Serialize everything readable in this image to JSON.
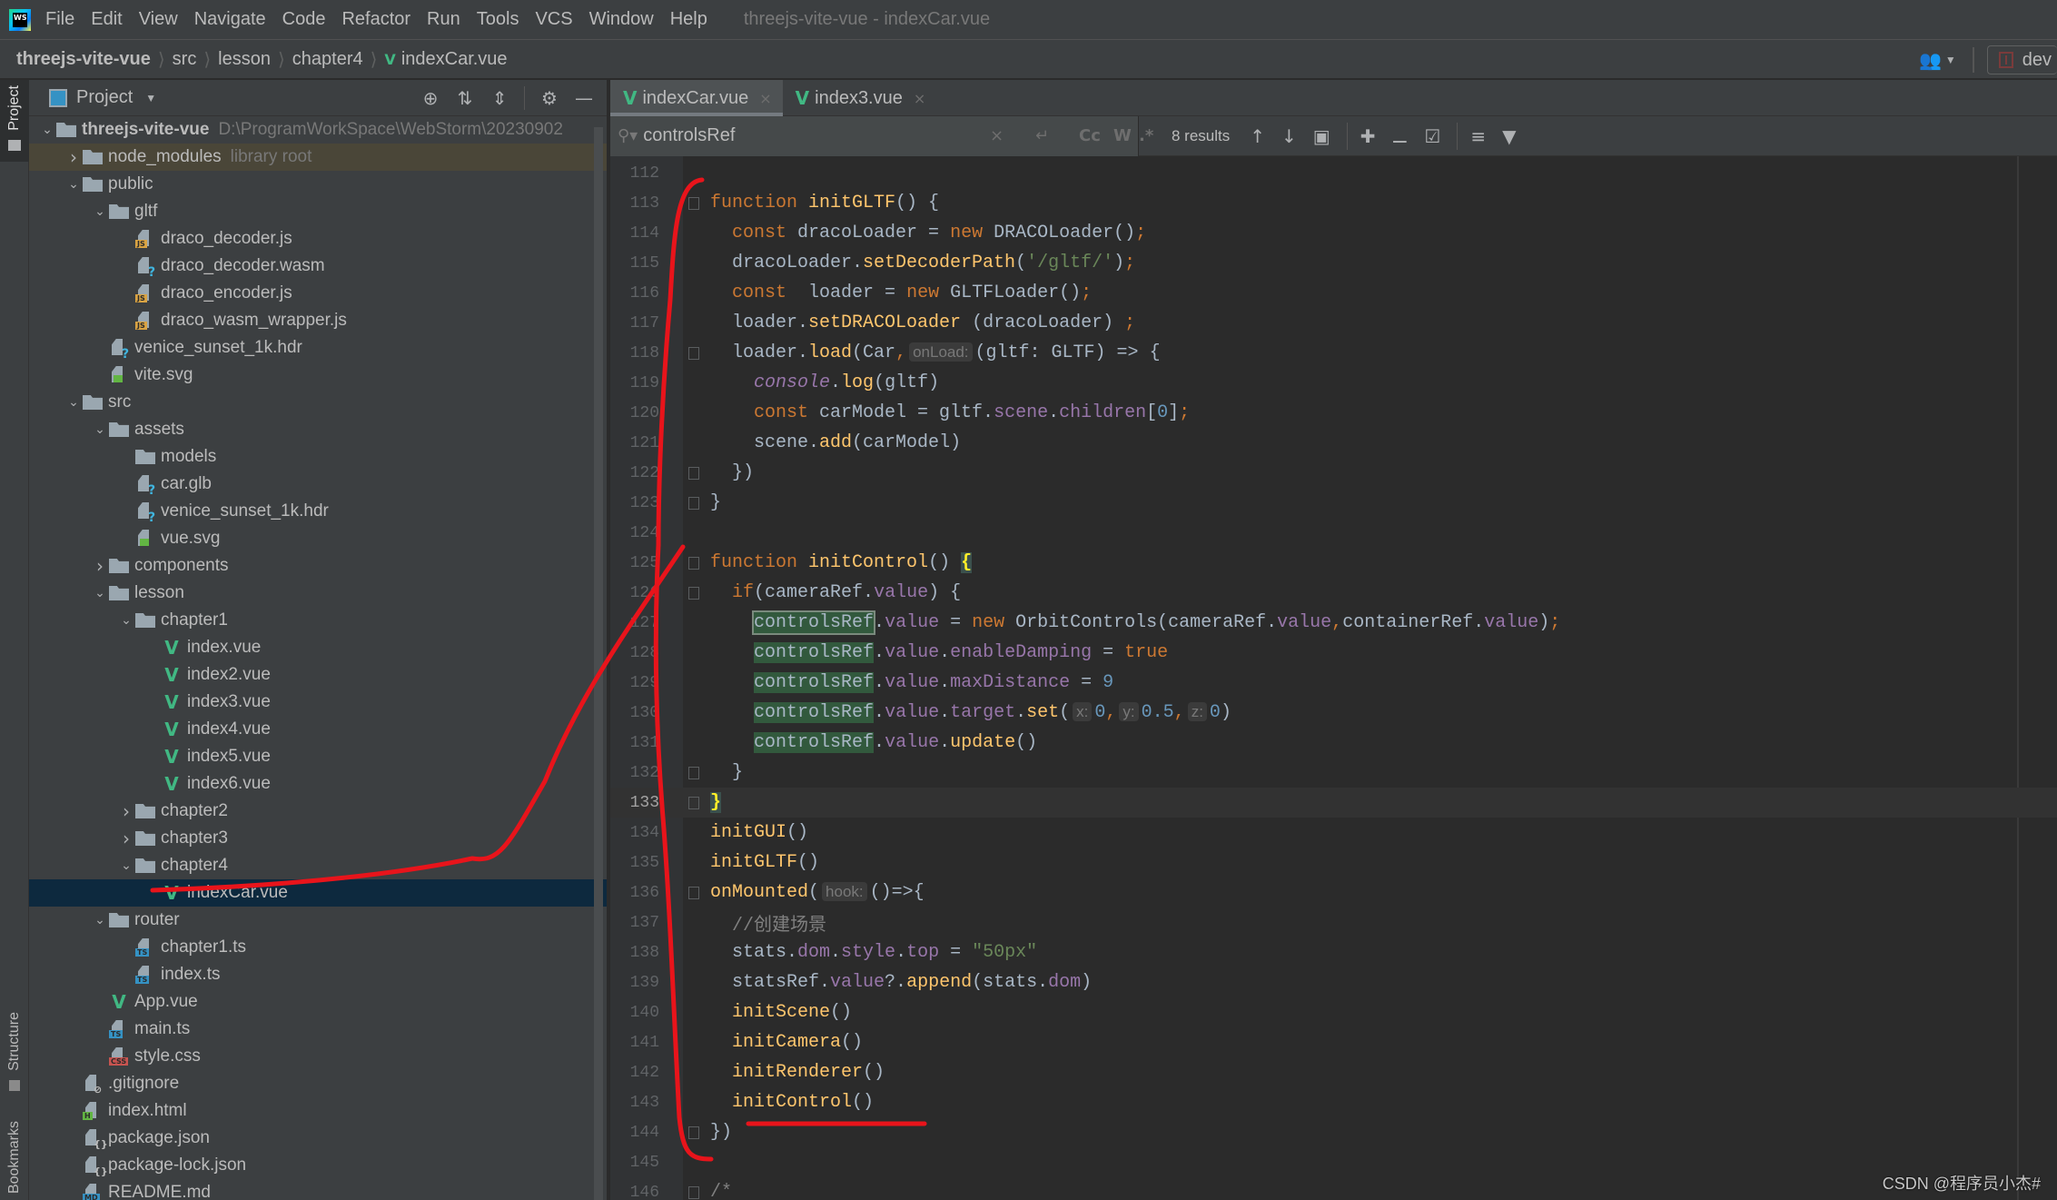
{
  "menu": {
    "app_logo": "WS",
    "items": [
      "File",
      "Edit",
      "View",
      "Navigate",
      "Code",
      "Refactor",
      "Run",
      "Tools",
      "VCS",
      "Window",
      "Help"
    ],
    "window_title": "threejs-vite-vue - indexCar.vue"
  },
  "breadcrumb": {
    "items": [
      "threejs-vite-vue",
      "src",
      "lesson",
      "chapter4",
      "indexCar.vue"
    ],
    "run_config": "dev"
  },
  "stripe": {
    "project": "Project",
    "structure": "Structure",
    "bookmarks": "Bookmarks"
  },
  "project_panel": {
    "title": "Project",
    "tree": [
      {
        "label": "threejs-vite-vue",
        "hint": "D:\\ProgramWorkSpace\\WebStorm\\20230902",
        "type": "folder",
        "depth": 0,
        "expanded": true,
        "bold": true
      },
      {
        "label": "node_modules",
        "hint": "library root",
        "type": "folder",
        "depth": 1,
        "expanded": false,
        "library": true
      },
      {
        "label": "public",
        "type": "folder",
        "depth": 1,
        "expanded": true
      },
      {
        "label": "gltf",
        "type": "folder",
        "depth": 2,
        "expanded": true
      },
      {
        "label": "draco_decoder.js",
        "type": "js",
        "depth": 3
      },
      {
        "label": "draco_decoder.wasm",
        "type": "unknown",
        "depth": 3
      },
      {
        "label": "draco_encoder.js",
        "type": "js",
        "depth": 3
      },
      {
        "label": "draco_wasm_wrapper.js",
        "type": "js",
        "depth": 3
      },
      {
        "label": "venice_sunset_1k.hdr",
        "type": "unknown",
        "depth": 2
      },
      {
        "label": "vite.svg",
        "type": "image",
        "depth": 2
      },
      {
        "label": "src",
        "type": "folder",
        "depth": 1,
        "expanded": true
      },
      {
        "label": "assets",
        "type": "folder",
        "depth": 2,
        "expanded": true
      },
      {
        "label": "models",
        "type": "folder",
        "depth": 3
      },
      {
        "label": "car.glb",
        "type": "unknown",
        "depth": 3
      },
      {
        "label": "venice_sunset_1k.hdr",
        "type": "unknown",
        "depth": 3
      },
      {
        "label": "vue.svg",
        "type": "image",
        "depth": 3
      },
      {
        "label": "components",
        "type": "folder",
        "depth": 2,
        "expanded": false
      },
      {
        "label": "lesson",
        "type": "folder",
        "depth": 2,
        "expanded": true
      },
      {
        "label": "chapter1",
        "type": "folder",
        "depth": 3,
        "expanded": true
      },
      {
        "label": "index.vue",
        "type": "vue",
        "depth": 4
      },
      {
        "label": "index2.vue",
        "type": "vue",
        "depth": 4
      },
      {
        "label": "index3.vue",
        "type": "vue",
        "depth": 4
      },
      {
        "label": "index4.vue",
        "type": "vue",
        "depth": 4
      },
      {
        "label": "index5.vue",
        "type": "vue",
        "depth": 4
      },
      {
        "label": "index6.vue",
        "type": "vue",
        "depth": 4
      },
      {
        "label": "chapter2",
        "type": "folder",
        "depth": 3,
        "expanded": false
      },
      {
        "label": "chapter3",
        "type": "folder",
        "depth": 3,
        "expanded": false
      },
      {
        "label": "chapter4",
        "type": "folder",
        "depth": 3,
        "expanded": true
      },
      {
        "label": "indexCar.vue",
        "type": "vue",
        "depth": 4,
        "selected": true
      },
      {
        "label": "router",
        "type": "folder",
        "depth": 2,
        "expanded": true
      },
      {
        "label": "chapter1.ts",
        "type": "ts",
        "depth": 3
      },
      {
        "label": "index.ts",
        "type": "ts",
        "depth": 3
      },
      {
        "label": "App.vue",
        "type": "vue",
        "depth": 2
      },
      {
        "label": "main.ts",
        "type": "ts",
        "depth": 2
      },
      {
        "label": "style.css",
        "type": "css",
        "depth": 2
      },
      {
        "label": ".gitignore",
        "type": "ignore",
        "depth": 1
      },
      {
        "label": "index.html",
        "type": "html",
        "depth": 1
      },
      {
        "label": "package.json",
        "type": "json",
        "depth": 1
      },
      {
        "label": "package-lock.json",
        "type": "json",
        "depth": 1
      },
      {
        "label": "README.md",
        "type": "md",
        "depth": 1
      }
    ]
  },
  "editor": {
    "tabs": [
      {
        "label": "indexCar.vue",
        "active": true
      },
      {
        "label": "index3.vue",
        "active": false
      }
    ],
    "search": {
      "value": "controlsRef",
      "results": "8 results",
      "options": [
        "Cc",
        "W",
        ".*"
      ]
    },
    "current_line": 133,
    "lines": [
      {
        "n": 112,
        "tokens": []
      },
      {
        "n": 113,
        "fold": true,
        "tokens": [
          [
            "kw",
            "function "
          ],
          [
            "fn",
            "initGLTF"
          ],
          [
            "",
            "() {"
          ]
        ]
      },
      {
        "n": 114,
        "tokens": [
          [
            "",
            "  "
          ],
          [
            "kw",
            "const "
          ],
          [
            "",
            "dracoLoader = "
          ],
          [
            "kw",
            "new "
          ],
          [
            "",
            "DRACOLoader()"
          ],
          [
            "kw",
            ";"
          ]
        ]
      },
      {
        "n": 115,
        "tokens": [
          [
            "",
            "  dracoLoader."
          ],
          [
            "fn",
            "setDecoderPath"
          ],
          [
            "",
            "("
          ],
          [
            "str",
            "'/gltf/'"
          ],
          [
            "",
            ")"
          ],
          [
            "kw",
            ";"
          ]
        ]
      },
      {
        "n": 116,
        "tokens": [
          [
            "",
            "  "
          ],
          [
            "kw",
            "const  "
          ],
          [
            "",
            "loader = "
          ],
          [
            "kw",
            "new "
          ],
          [
            "",
            "GLTFLoader()"
          ],
          [
            "kw",
            ";"
          ]
        ]
      },
      {
        "n": 117,
        "tokens": [
          [
            "",
            "  loader."
          ],
          [
            "fn",
            "setDRACOLoader"
          ],
          [
            "",
            " (dracoLoader) "
          ],
          [
            "kw",
            ";"
          ]
        ]
      },
      {
        "n": 118,
        "fold": true,
        "tokens": [
          [
            "",
            "  loader."
          ],
          [
            "fn",
            "load"
          ],
          [
            "",
            "(Car"
          ],
          [
            "kw",
            ","
          ],
          [
            "hint",
            "onLoad:"
          ],
          [
            "",
            "(gltf: GLTF) => {"
          ]
        ]
      },
      {
        "n": 119,
        "tokens": [
          [
            "",
            "    "
          ],
          [
            "glob",
            "console"
          ],
          [
            "",
            "."
          ],
          [
            "fn",
            "log"
          ],
          [
            "",
            "(gltf)"
          ]
        ]
      },
      {
        "n": 120,
        "tokens": [
          [
            "",
            "    "
          ],
          [
            "kw",
            "const "
          ],
          [
            "",
            "carModel = gltf."
          ],
          [
            "prop",
            "scene"
          ],
          [
            "",
            "."
          ],
          [
            "prop",
            "children"
          ],
          [
            "",
            "["
          ],
          [
            "num",
            "0"
          ],
          [
            "",
            "]"
          ],
          [
            "kw",
            ";"
          ]
        ]
      },
      {
        "n": 121,
        "tokens": [
          [
            "",
            "    scene."
          ],
          [
            "fn",
            "add"
          ],
          [
            "",
            "(carModel)"
          ]
        ]
      },
      {
        "n": 122,
        "fold": true,
        "tokens": [
          [
            "",
            "  })"
          ]
        ]
      },
      {
        "n": 123,
        "fold": true,
        "tokens": [
          [
            "",
            "}"
          ]
        ]
      },
      {
        "n": 124,
        "tokens": []
      },
      {
        "n": 125,
        "fold": true,
        "tokens": [
          [
            "kw",
            "function "
          ],
          [
            "fn",
            "initControl"
          ],
          [
            "",
            "() "
          ],
          [
            "brace",
            "{"
          ]
        ]
      },
      {
        "n": 126,
        "fold": true,
        "tokens": [
          [
            "",
            "  "
          ],
          [
            "kw",
            "if"
          ],
          [
            "",
            "(cameraRef."
          ],
          [
            "prop",
            "value"
          ],
          [
            "",
            ") {"
          ]
        ]
      },
      {
        "n": 127,
        "tokens": [
          [
            "",
            "    "
          ],
          [
            "matchcur",
            "controlsRef"
          ],
          [
            "",
            "."
          ],
          [
            "prop",
            "value"
          ],
          [
            "",
            " = "
          ],
          [
            "kw",
            "new "
          ],
          [
            "",
            "OrbitControls(cameraRef."
          ],
          [
            "prop",
            "value"
          ],
          [
            "kw",
            ","
          ],
          [
            "",
            "containerRef."
          ],
          [
            "prop",
            "value"
          ],
          [
            "",
            ")"
          ],
          [
            "kw",
            ";"
          ]
        ]
      },
      {
        "n": 128,
        "tokens": [
          [
            "",
            "    "
          ],
          [
            "match",
            "controlsRef"
          ],
          [
            "",
            "."
          ],
          [
            "prop",
            "value"
          ],
          [
            "",
            "."
          ],
          [
            "prop",
            "enableDamping"
          ],
          [
            "",
            " = "
          ],
          [
            "kw",
            "true"
          ]
        ]
      },
      {
        "n": 129,
        "tokens": [
          [
            "",
            "    "
          ],
          [
            "match",
            "controlsRef"
          ],
          [
            "",
            "."
          ],
          [
            "prop",
            "value"
          ],
          [
            "",
            "."
          ],
          [
            "prop",
            "maxDistance"
          ],
          [
            "",
            " = "
          ],
          [
            "num",
            "9"
          ]
        ]
      },
      {
        "n": 130,
        "tokens": [
          [
            "",
            "    "
          ],
          [
            "match",
            "controlsRef"
          ],
          [
            "",
            "."
          ],
          [
            "prop",
            "value"
          ],
          [
            "",
            "."
          ],
          [
            "prop",
            "target"
          ],
          [
            "",
            "."
          ],
          [
            "fn",
            "set"
          ],
          [
            "",
            "("
          ],
          [
            "hint",
            "x:"
          ],
          [
            "num",
            "0"
          ],
          [
            "kw",
            ","
          ],
          [
            "hint",
            "y:"
          ],
          [
            "num",
            "0.5"
          ],
          [
            "kw",
            ","
          ],
          [
            "hint",
            "z:"
          ],
          [
            "num",
            "0"
          ],
          [
            "",
            ")"
          ]
        ]
      },
      {
        "n": 131,
        "tokens": [
          [
            "",
            "    "
          ],
          [
            "match",
            "controlsRef"
          ],
          [
            "",
            "."
          ],
          [
            "prop",
            "value"
          ],
          [
            "",
            "."
          ],
          [
            "fn",
            "update"
          ],
          [
            "",
            "()"
          ]
        ]
      },
      {
        "n": 132,
        "fold": true,
        "tokens": [
          [
            "",
            "  }"
          ]
        ]
      },
      {
        "n": 133,
        "fold": true,
        "tokens": [
          [
            "brace",
            "}"
          ]
        ]
      },
      {
        "n": 134,
        "tokens": [
          [
            "fn",
            "initGUI"
          ],
          [
            "",
            "()"
          ]
        ]
      },
      {
        "n": 135,
        "tokens": [
          [
            "fn",
            "initGLTF"
          ],
          [
            "",
            "()"
          ]
        ]
      },
      {
        "n": 136,
        "fold": true,
        "tokens": [
          [
            "fn",
            "onMounted"
          ],
          [
            "",
            "("
          ],
          [
            "hint",
            "hook:"
          ],
          [
            "",
            "()=>{"
          ]
        ]
      },
      {
        "n": 137,
        "tokens": [
          [
            "",
            "  "
          ],
          [
            "cmt",
            "//创建场景"
          ]
        ]
      },
      {
        "n": 138,
        "tokens": [
          [
            "",
            "  stats."
          ],
          [
            "prop",
            "dom"
          ],
          [
            "",
            "."
          ],
          [
            "prop",
            "style"
          ],
          [
            "",
            "."
          ],
          [
            "prop",
            "top"
          ],
          [
            "",
            " = "
          ],
          [
            "str",
            "\"50px\""
          ]
        ]
      },
      {
        "n": 139,
        "tokens": [
          [
            "",
            "  statsRef."
          ],
          [
            "prop",
            "value"
          ],
          [
            "",
            "?."
          ],
          [
            "fn",
            "append"
          ],
          [
            "",
            "(stats."
          ],
          [
            "prop",
            "dom"
          ],
          [
            "",
            ")"
          ]
        ]
      },
      {
        "n": 140,
        "tokens": [
          [
            "",
            "  "
          ],
          [
            "fn",
            "initScene"
          ],
          [
            "",
            "()"
          ]
        ]
      },
      {
        "n": 141,
        "tokens": [
          [
            "",
            "  "
          ],
          [
            "fn",
            "initCamera"
          ],
          [
            "",
            "()"
          ]
        ]
      },
      {
        "n": 142,
        "tokens": [
          [
            "",
            "  "
          ],
          [
            "fn",
            "initRenderer"
          ],
          [
            "",
            "()"
          ]
        ]
      },
      {
        "n": 143,
        "tokens": [
          [
            "",
            "  "
          ],
          [
            "fn",
            "initControl"
          ],
          [
            "",
            "()"
          ]
        ]
      },
      {
        "n": 144,
        "fold": true,
        "tokens": [
          [
            "",
            "})"
          ]
        ]
      },
      {
        "n": 145,
        "tokens": []
      },
      {
        "n": 146,
        "fold": true,
        "tokens": [
          [
            "cmt",
            "/*"
          ]
        ]
      }
    ]
  },
  "watermark": "CSDN @程序员小杰#",
  "colors": {
    "annotation_red": "#e8141b",
    "vue_green": "#41b883",
    "match_bg": "#32593d"
  }
}
